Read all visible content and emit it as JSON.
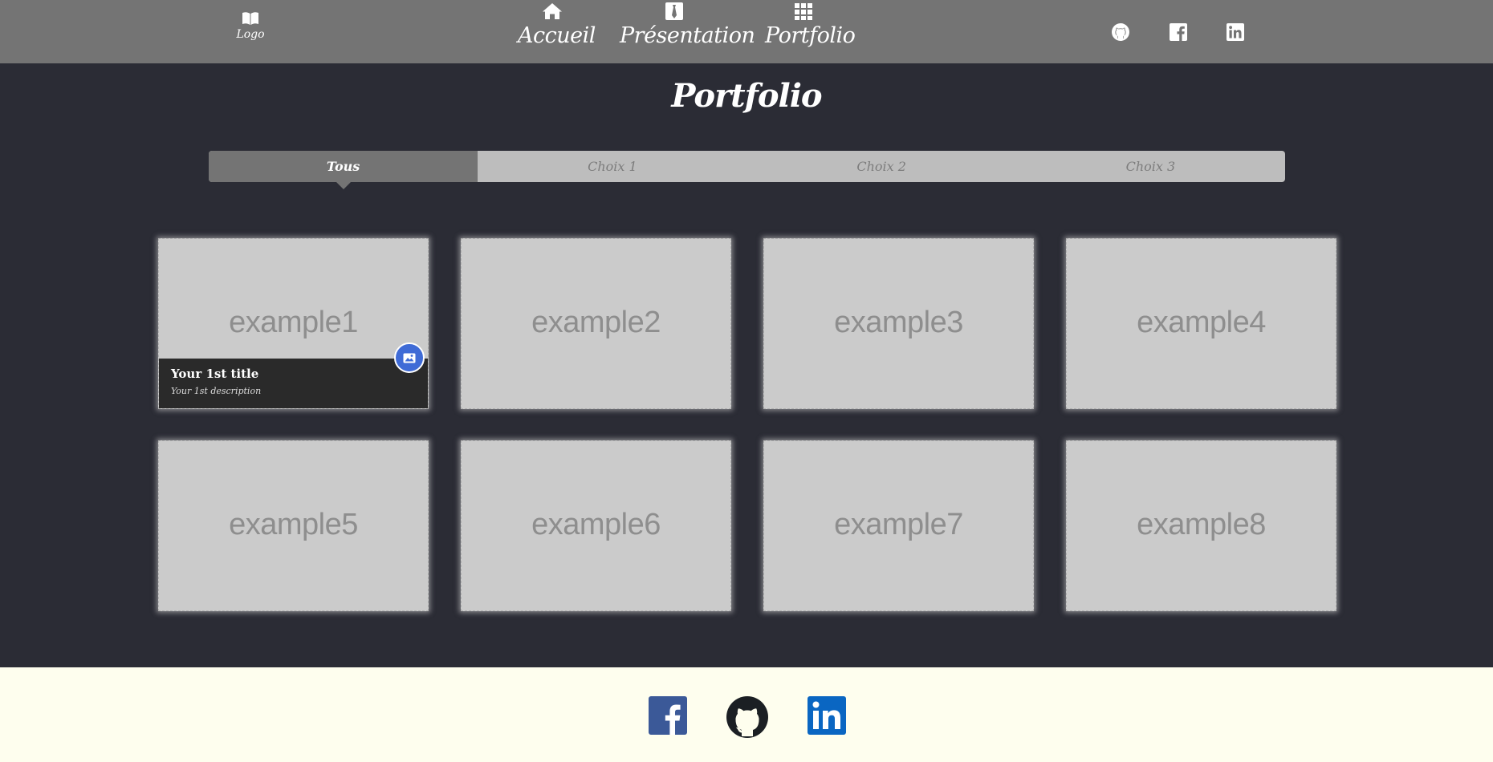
{
  "header": {
    "logo_label": "Logo",
    "nav": [
      {
        "label": "Accueil",
        "icon": "home-icon"
      },
      {
        "label": "Présentation",
        "icon": "tie-icon"
      },
      {
        "label": "Portfolio",
        "icon": "grid-icon"
      }
    ],
    "social": [
      "github-icon",
      "facebook-icon",
      "linkedin-icon"
    ]
  },
  "page": {
    "title": "Portfolio"
  },
  "filters": {
    "active": "Tous",
    "tabs": [
      "Tous",
      "Choix 1",
      "Choix 2",
      "Choix 3"
    ]
  },
  "gallery": {
    "items": [
      {
        "label": "example1"
      },
      {
        "label": "example2"
      },
      {
        "label": "example3"
      },
      {
        "label": "example4"
      },
      {
        "label": "example5"
      },
      {
        "label": "example6"
      },
      {
        "label": "example7"
      },
      {
        "label": "example8"
      }
    ],
    "hover_caption": {
      "title": "Your 1st title",
      "description": "Your 1st description",
      "icon": "image-icon"
    }
  },
  "footer": {
    "social": [
      "facebook-icon",
      "github-icon",
      "linkedin-icon"
    ]
  },
  "colors": {
    "header_bg": "#747474",
    "page_bg": "#2b2c35",
    "filter_bg": "#bdbdbd",
    "card_bg": "#cbcbcb",
    "footer_bg": "#fefeee",
    "badge_blue": "#3f6bd6",
    "facebook_blue": "#3b5998",
    "linkedin_blue": "#0a66c2"
  }
}
